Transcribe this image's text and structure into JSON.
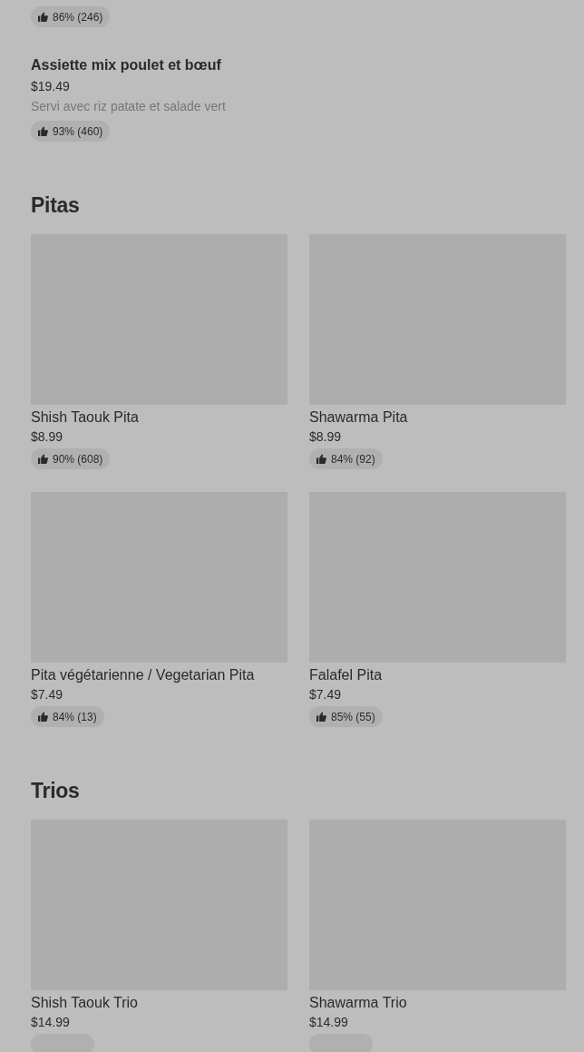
{
  "list_items": [
    {
      "rating": "86% (246)"
    },
    {
      "name": "Assiette mix poulet et bœuf",
      "price": "$19.49",
      "description": "Servi avec riz patate et salade vert",
      "rating": "93% (460)"
    }
  ],
  "sections": [
    {
      "title": "Pitas",
      "cards": [
        {
          "name": "Shish Taouk Pita",
          "price": "$8.99",
          "rating": "90% (608)"
        },
        {
          "name": "Shawarma Pita",
          "price": "$8.99",
          "rating": "84% (92)"
        },
        {
          "name": "Pita végétarienne / Vegetarian Pita",
          "price": "$7.49",
          "rating": "84% (13)"
        },
        {
          "name": "Falafel Pita",
          "price": "$7.49",
          "rating": "85% (55)"
        }
      ]
    },
    {
      "title": "Trios",
      "cards": [
        {
          "name": "Shish Taouk Trio",
          "price": "$14.99"
        },
        {
          "name": "Shawarma Trio",
          "price": "$14.99"
        }
      ]
    }
  ]
}
